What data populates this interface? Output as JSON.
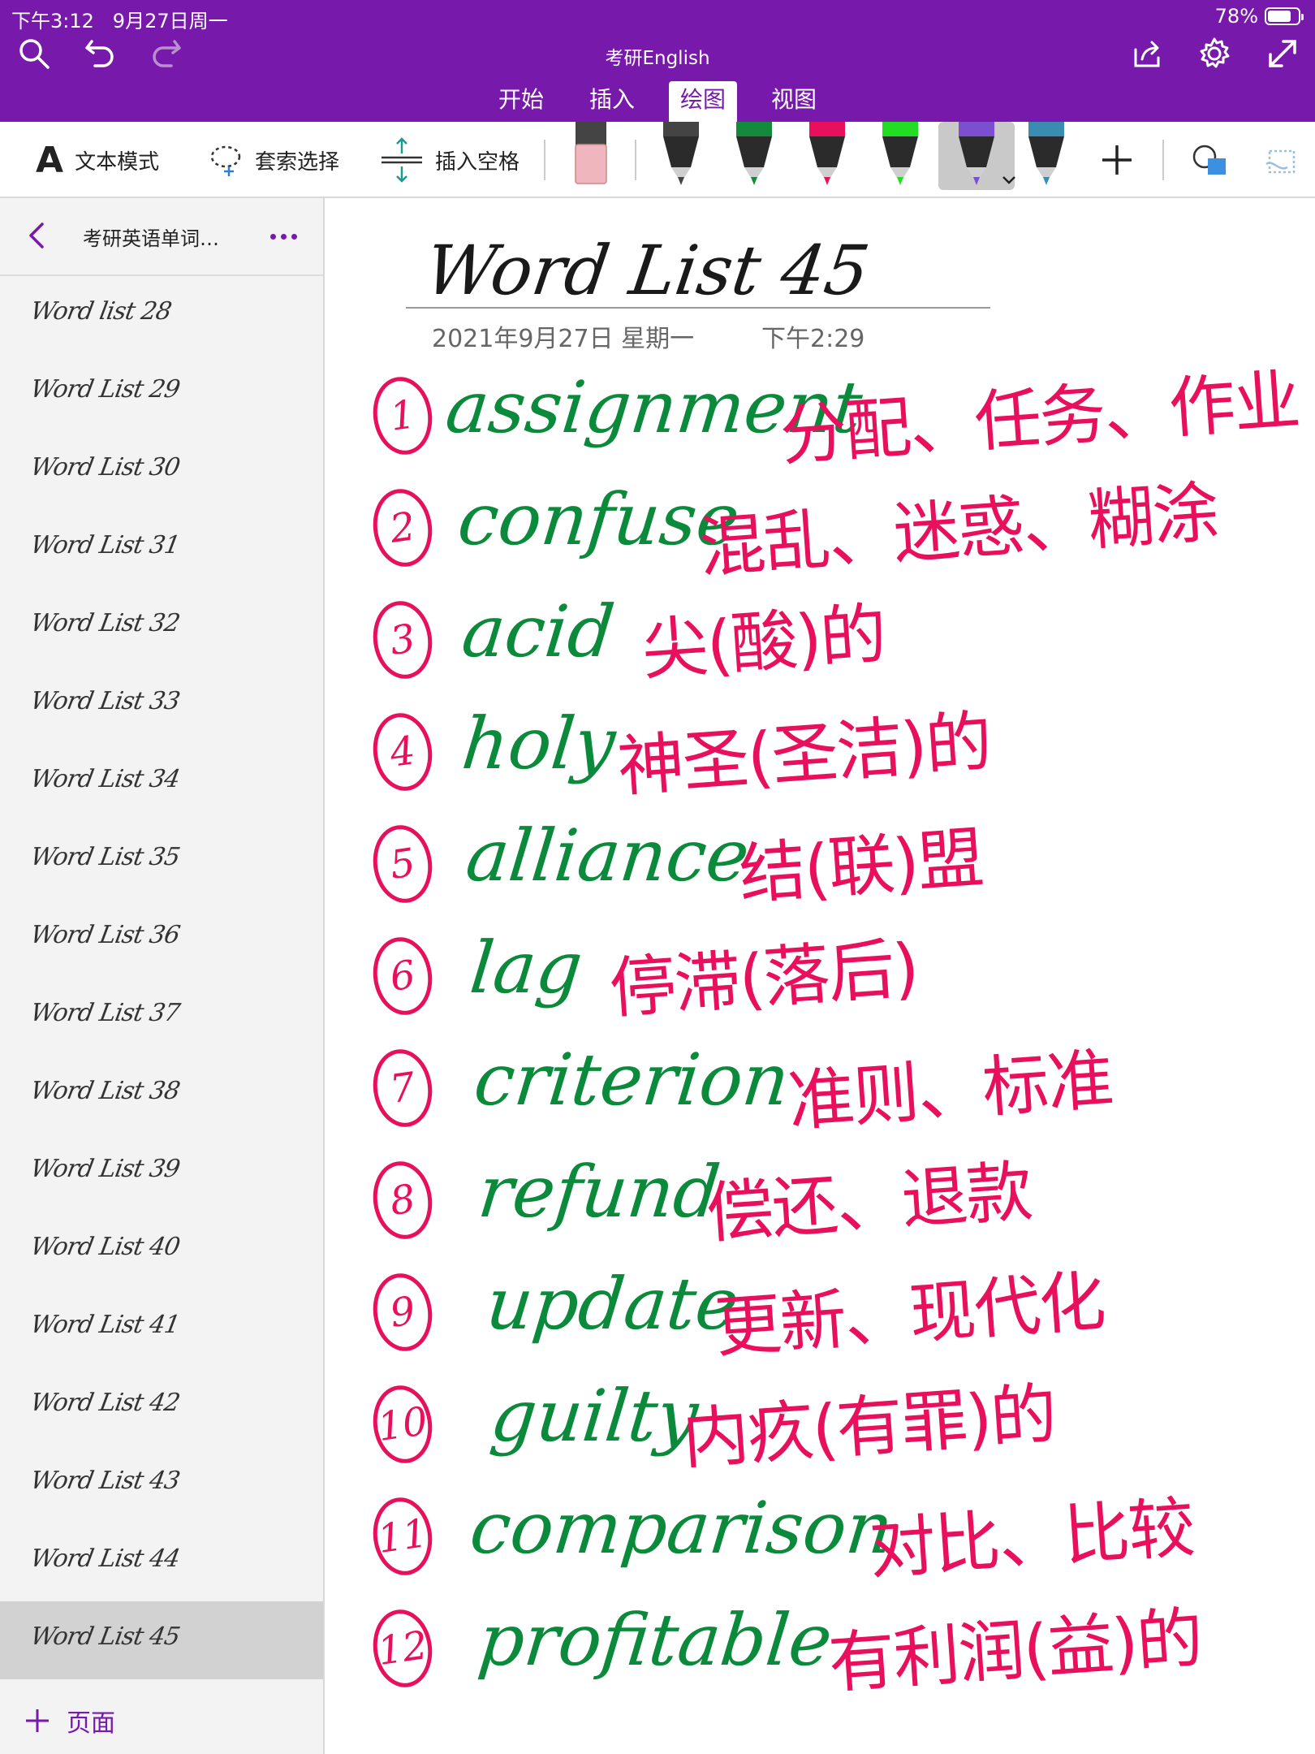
{
  "status": {
    "time": "下午3:12",
    "date": "9月27日周一",
    "battery": "78%",
    "battery_level": 0.78
  },
  "app": {
    "title": "考研English"
  },
  "ribbon_tabs": [
    "开始",
    "插入",
    "绘图",
    "视图"
  ],
  "active_tab": "绘图",
  "toolbar": {
    "text_mode": "文本模式",
    "lasso": "套索选择",
    "insert_space": "插入空格"
  },
  "pens": [
    {
      "color": "#444444"
    },
    {
      "color": "#138A3C"
    },
    {
      "color": "#E8105C"
    },
    {
      "color": "#22DD22"
    },
    {
      "color": "#7B4FD0"
    },
    {
      "color": "#3A8CB0"
    }
  ],
  "sidebar": {
    "section_title": "考研英语单词…",
    "pages": [
      "Word list 28",
      "Word List 29",
      "Word List 30",
      "Word List 31",
      "Word List 32",
      "Word List 33",
      "Word List 34",
      "Word List 35",
      "Word List 36",
      "Word List 37",
      "Word List 38",
      "Word List 39",
      "Word List 40",
      "Word List 41",
      "Word List 42",
      "Word List 43",
      "Word List 44",
      "Word List 45"
    ],
    "selected_index": 17,
    "add_page": "页面"
  },
  "note": {
    "title": "Word List 45",
    "date": "2021年9月27日 星期一",
    "time": "下午2:29",
    "entries": [
      {
        "num": "1",
        "word": "assignment",
        "meaning": "分配、任务、作业"
      },
      {
        "num": "2",
        "word": "confuse",
        "meaning": "混乱、迷惑、糊涂"
      },
      {
        "num": "3",
        "word": "acid",
        "meaning": "尖(酸)的"
      },
      {
        "num": "4",
        "word": "holy",
        "meaning": "神圣(圣洁)的"
      },
      {
        "num": "5",
        "word": "alliance",
        "meaning": "结(联)盟"
      },
      {
        "num": "6",
        "word": "lag",
        "meaning": "停滞(落后)"
      },
      {
        "num": "7",
        "word": "criterion",
        "meaning": "准则、标准"
      },
      {
        "num": "8",
        "word": "refund",
        "meaning": "偿还、退款"
      },
      {
        "num": "9",
        "word": "update",
        "meaning": "更新、现代化"
      },
      {
        "num": "10",
        "word": "guilty",
        "meaning": "内疚(有罪)的"
      },
      {
        "num": "11",
        "word": "comparison",
        "meaning": "对比、比较"
      },
      {
        "num": "12",
        "word": "profitable",
        "meaning": "有利润(益)的"
      }
    ]
  }
}
